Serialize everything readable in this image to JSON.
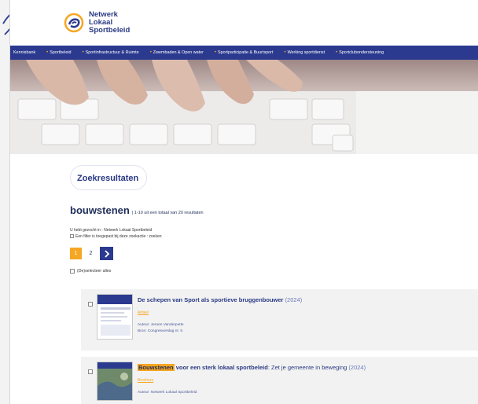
{
  "logo": {
    "line1": "Netwerk",
    "line2": "Lokaal",
    "line3": "Sportbeleid"
  },
  "nav": {
    "items": [
      {
        "label": "Kennisbank",
        "dot": false
      },
      {
        "label": "Sportbeleid",
        "dot": true
      },
      {
        "label": "Sportinfrastructuur & Ruimte",
        "dot": true
      },
      {
        "label": "Zwembaden & Open water",
        "dot": true
      },
      {
        "label": "Sportparticipatie & Buurtsport",
        "dot": true
      },
      {
        "label": "Werking sportdienst",
        "dot": true
      },
      {
        "label": "Sportclubondersteuning",
        "dot": true
      }
    ]
  },
  "page_title": "Zoekresultaten",
  "query": {
    "term": "bouwstenen",
    "count_text": "| 1-10 uit een totaal van 20 resultaten"
  },
  "search_info": {
    "line1": "U hebt gezocht in : Netwerk Lokaal Sportbeleid",
    "line2": "Een filter is toegepast bij deze zoekactie : zoeken"
  },
  "pagination": {
    "current": "1",
    "page2": "2",
    "next_icon": "chevron-right"
  },
  "select_all_label": "(De)selecteer alles",
  "results": [
    {
      "title": "De schepen van Sport als sportieve bruggenbouwer",
      "year": "(2024)",
      "tag": "Artikel",
      "author": "Auteur: Jeroen Vanderputte",
      "source": "Bron: Congresverslag nr. 5"
    },
    {
      "title_highlight": "Bouwstenen",
      "title_rest": "voor een sterk lokaal sportbeleid",
      "title_subtitle": ": Zet je gemeente in beweging",
      "year": "(2024)",
      "tag": "Brochure",
      "author": "Auteur: Netwerk Lokaal Sportbeleid"
    }
  ],
  "colors": {
    "brand_blue": "#2b3a8f",
    "accent_orange": "#f5a623"
  }
}
